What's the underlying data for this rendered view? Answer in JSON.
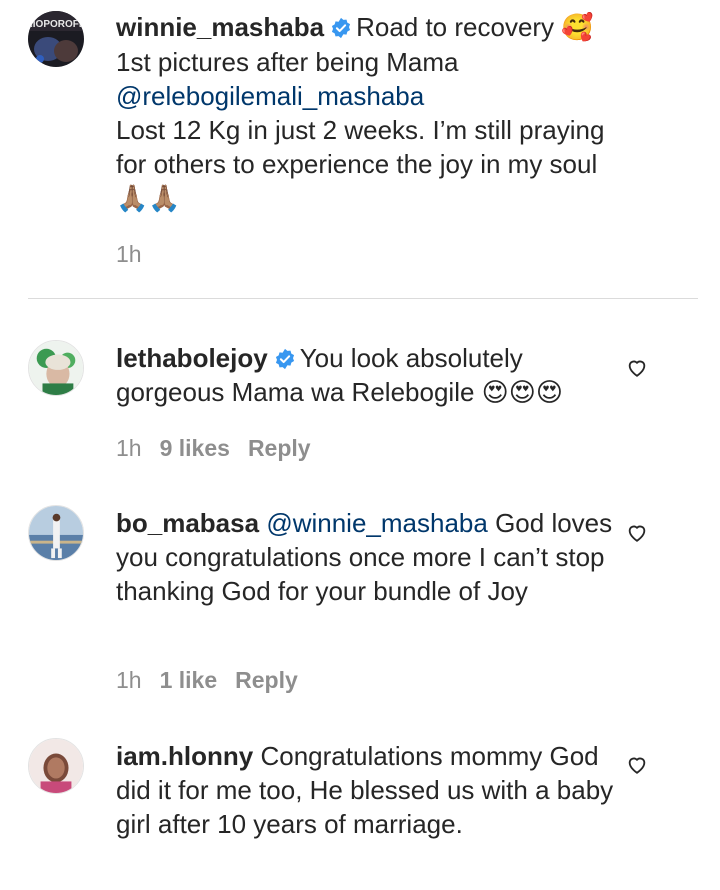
{
  "caption": {
    "username": "winnie_mashaba",
    "text_first": "Road to recovery",
    "emoji_first": "🥰",
    "line2": "1st pictures after being Mama",
    "mention": "@relebogilemali_mashaba",
    "line4": "Lost 12 Kg in just 2 weeks. I’m still praying for others to experience the joy in my soul",
    "emoji_end": "🙏🏽🙏🏽",
    "time": "1h",
    "avatar_text": "IIOPOROFET"
  },
  "comments": [
    {
      "username": "lethabolejoy",
      "verified": true,
      "text": "You look absolutely gorgeous Mama wa Relebogile",
      "emoji": "😍😍😍",
      "time": "1h",
      "likes": "9 likes",
      "reply": "Reply"
    },
    {
      "username": "bo_mabasa",
      "mention": "@winnie_mashaba",
      "text": "God loves you congratulations once more I can’t stop thanking God for your bundle of Joy",
      "time": "1h",
      "likes": "1 like",
      "reply": "Reply"
    },
    {
      "username": "iam.hlonny",
      "text": "Congratulations mommy God did it for me too, He blessed us with a baby girl after 10 years of marriage."
    }
  ],
  "colors": {
    "verified": "#3897f0",
    "mention": "#00376b",
    "meta": "#8e8e8e"
  }
}
